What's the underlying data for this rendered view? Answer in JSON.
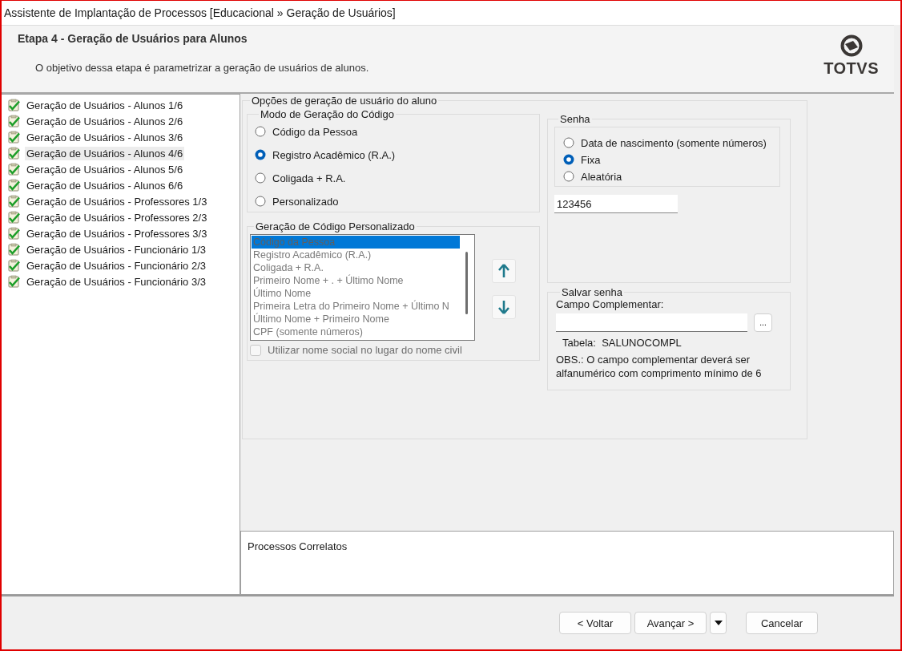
{
  "window": {
    "title": "Assistente de Implantação de Processos [Educacional » Geração de Usuários]"
  },
  "header": {
    "title": "Etapa 4 - Geração de Usuários para Alunos",
    "description": "O objetivo dessa etapa é parametrizar a geração de usuários de alunos.",
    "logo_text": "TOTVS"
  },
  "steps": [
    {
      "label": "Geração de Usuários - Alunos 1/6",
      "done": true,
      "selected": false
    },
    {
      "label": "Geração de Usuários - Alunos 2/6",
      "done": true,
      "selected": false
    },
    {
      "label": "Geração de Usuários - Alunos 3/6",
      "done": true,
      "selected": false
    },
    {
      "label": "Geração de Usuários - Alunos 4/6",
      "done": true,
      "selected": true
    },
    {
      "label": "Geração de Usuários - Alunos 5/6",
      "done": true,
      "selected": false
    },
    {
      "label": "Geração de Usuários - Alunos 6/6",
      "done": true,
      "selected": false
    },
    {
      "label": "Geração de Usuários - Professores 1/3",
      "done": true,
      "selected": false
    },
    {
      "label": "Geração de Usuários - Professores 2/3",
      "done": true,
      "selected": false
    },
    {
      "label": "Geração de Usuários - Professores 3/3",
      "done": true,
      "selected": false
    },
    {
      "label": "Geração de Usuários - Funcionário 1/3",
      "done": true,
      "selected": false
    },
    {
      "label": "Geração de Usuários - Funcionário 2/3",
      "done": true,
      "selected": false
    },
    {
      "label": "Geração de Usuários - Funcionário 3/3",
      "done": true,
      "selected": false
    }
  ],
  "options": {
    "title": "Opções de geração de usuário do aluno",
    "code_mode": {
      "title": "Modo de Geração do Código",
      "options": [
        {
          "label": "Código da Pessoa",
          "selected": false
        },
        {
          "label": "Registro Acadêmico (R.A.)",
          "selected": true
        },
        {
          "label": "Coligada + R.A.",
          "selected": false
        },
        {
          "label": "Personalizado",
          "selected": false
        }
      ]
    },
    "custom_code": {
      "title": "Geração de Código Personalizado",
      "disabled": true,
      "items": [
        {
          "label": "Código da Pessoa",
          "selected": true
        },
        {
          "label": "Registro Acadêmico (R.A.)",
          "selected": false
        },
        {
          "label": "Coligada + R.A.",
          "selected": false
        },
        {
          "label": "Primeiro Nome + . + Último Nome",
          "selected": false
        },
        {
          "label": "Último Nome",
          "selected": false
        },
        {
          "label": "Primeira Letra do Primeiro Nome + Último N",
          "selected": false
        },
        {
          "label": "Último Nome + Primeiro Nome",
          "selected": false
        },
        {
          "label": "CPF (somente números)",
          "selected": false
        }
      ],
      "social_name": {
        "label": "Utilizar nome social no lugar do nome civil",
        "checked": false
      }
    },
    "password": {
      "title": "Senha",
      "options": [
        {
          "label": "Data de nascimento (somente números)",
          "selected": false
        },
        {
          "label": "Fixa",
          "selected": true
        },
        {
          "label": "Aleatória",
          "selected": false
        }
      ],
      "value": "123456"
    },
    "save_password": {
      "title": "Salvar senha",
      "field_label": "Campo Complementar:",
      "browse_label": "...",
      "table": "Tabela:  SALUNOCOMPL",
      "note": "OBS.: O campo complementar deverá ser alfanumérico com comprimento mínimo de 6"
    }
  },
  "related": {
    "title": "Processos Correlatos"
  },
  "buttons": [
    {
      "kind": "button",
      "label": "< Voltar"
    },
    {
      "kind": "button",
      "label": "Avançar >"
    },
    {
      "kind": "menu"
    },
    {
      "kind": "button",
      "label": "Cancelar"
    }
  ]
}
